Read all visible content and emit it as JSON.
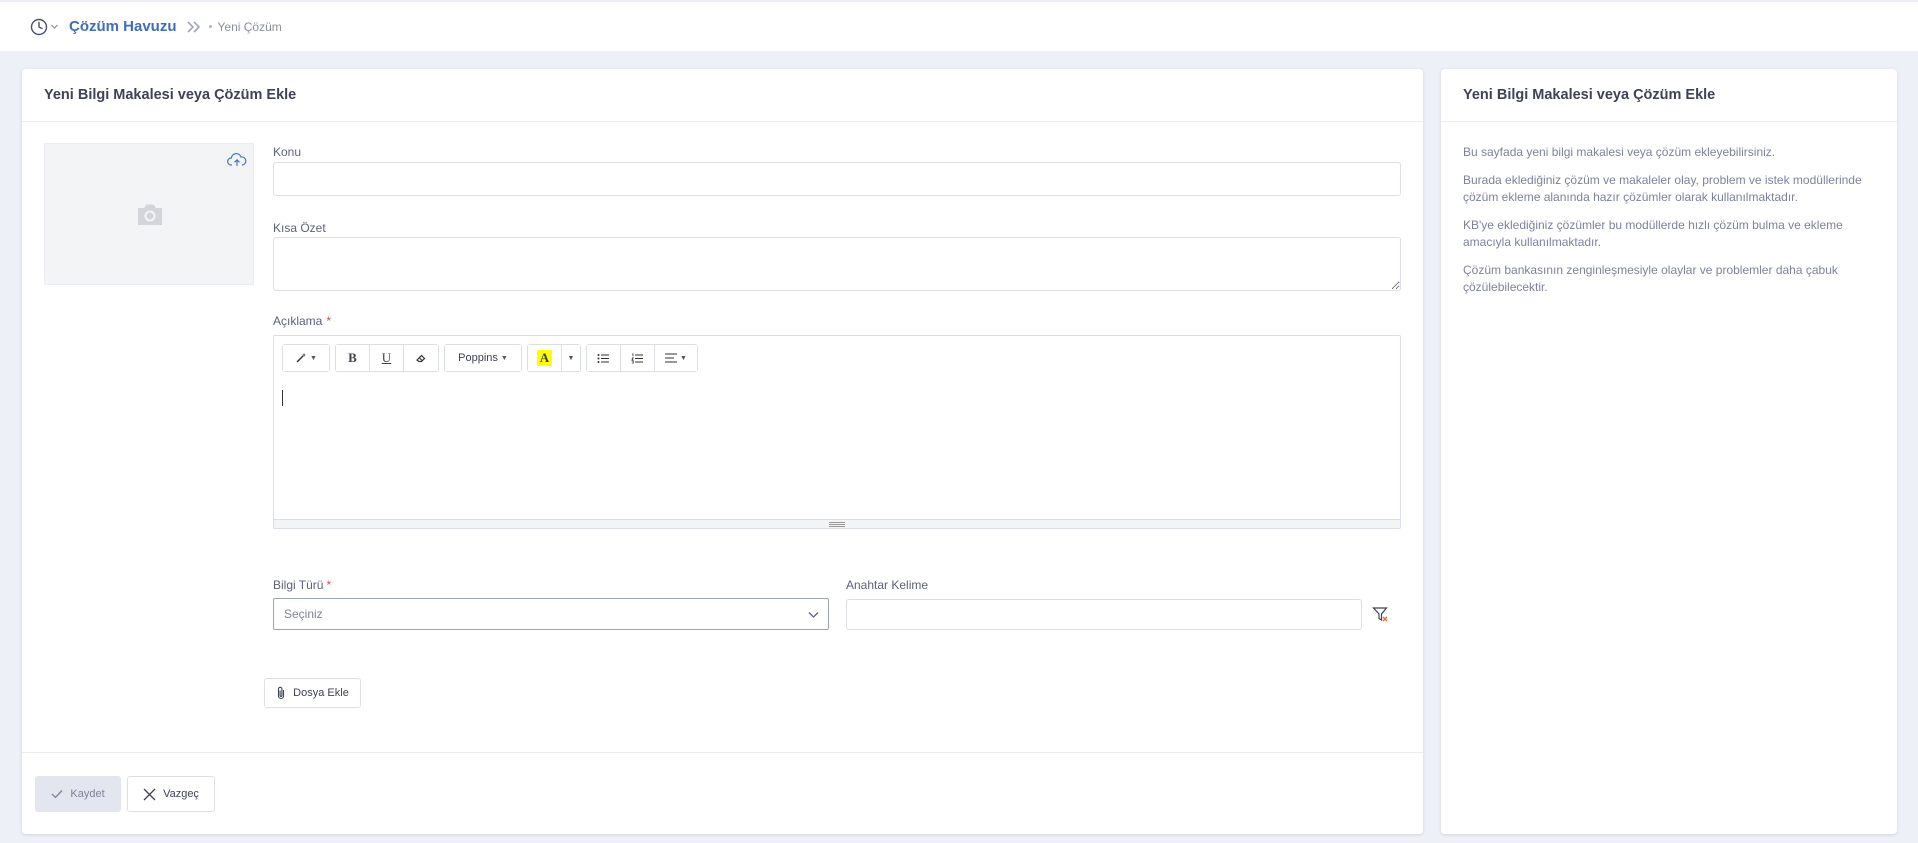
{
  "breadcrumb": {
    "root": "Çözüm Havuzu",
    "current": "Yeni Çözüm"
  },
  "form": {
    "title": "Yeni Bilgi Makalesi veya Çözüm Ekle",
    "subject_label": "Konu",
    "subject_value": "",
    "summary_label": "Kısa Özet",
    "summary_value": "",
    "description_label": "Açıklama",
    "required_mark": "*",
    "editor": {
      "font_label": "Poppins",
      "bold": "B",
      "underline": "U",
      "highlight": "A"
    },
    "type_label": "Bilgi Türü",
    "type_selected": "Seçiniz",
    "keyword_label": "Anahtar Kelime",
    "keyword_value": "",
    "attach_label": "Dosya Ekle",
    "save_label": "Kaydet",
    "cancel_label": "Vazgeç"
  },
  "side": {
    "title": "Yeni Bilgi Makalesi veya Çözüm Ekle",
    "paragraphs": [
      "Bu sayfada yeni bilgi makalesi veya çözüm ekleyebilirsiniz.",
      "Burada eklediğiniz çözüm ve makaleler olay, problem ve istek modüllerinde çözüm ekleme alanında hazır çözümler olarak kullanılmaktadır.",
      "KB'ye eklediğiniz çözümler bu modüllerde hızlı çözüm bulma ve ekleme amacıyla kullanılmaktadır.",
      "Çözüm bankasının zenginleşmesiyle olaylar ve problemler daha çabuk çözülebilecektir."
    ]
  },
  "colors": {
    "accent": "#3d6dc4",
    "background": "#eef0f8",
    "required": "#e04646",
    "highlight": "#ffff00"
  }
}
